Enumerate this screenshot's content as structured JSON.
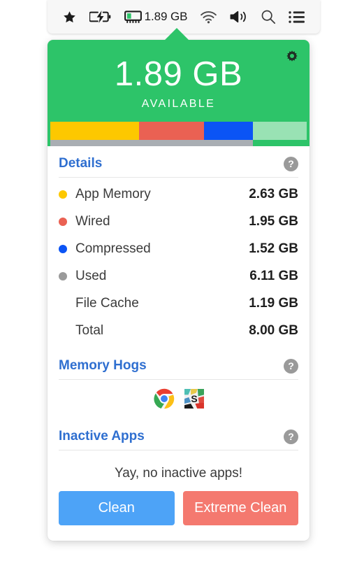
{
  "menubar": {
    "icons": [
      {
        "name": "star-icon",
        "label": "star"
      },
      {
        "name": "battery-charging-icon",
        "label": "battery charging"
      },
      {
        "name": "ram-chip-icon",
        "label": "memory chip"
      }
    ],
    "ram_text": "1.89 GB",
    "trailing_icons": [
      {
        "name": "wifi-icon",
        "label": "wifi"
      },
      {
        "name": "volume-icon",
        "label": "volume"
      },
      {
        "name": "search-icon",
        "label": "search"
      },
      {
        "name": "list-icon",
        "label": "notification center"
      }
    ]
  },
  "header": {
    "available_value": "1.89 GB",
    "available_label": "AVAILABLE",
    "gear_icon": "gear-icon",
    "background_color": "#2dc469"
  },
  "memory_bar": {
    "segments": [
      {
        "name": "app-memory",
        "color": "#fdc800",
        "percent": 34.5
      },
      {
        "name": "wired",
        "color": "#ea6153",
        "percent": 25.5
      },
      {
        "name": "compressed",
        "color": "#0b54f5",
        "percent": 19.0
      },
      {
        "name": "free",
        "color": "#99e2b4",
        "percent": 21.0
      }
    ],
    "underbar_color": "#a9aeb3",
    "underbar_percent": 79
  },
  "details": {
    "title": "Details",
    "help_label": "?",
    "rows": [
      {
        "dot": "#fdc800",
        "label": "App Memory",
        "value": "2.63 GB"
      },
      {
        "dot": "#ea6153",
        "label": "Wired",
        "value": "1.95 GB"
      },
      {
        "dot": "#0b54f5",
        "label": "Compressed",
        "value": "1.52 GB"
      },
      {
        "dot": "#9a9a9a",
        "label": "Used",
        "value": "6.11 GB"
      },
      {
        "dot": null,
        "label": "File Cache",
        "value": "1.19 GB"
      },
      {
        "dot": null,
        "label": "Total",
        "value": "8.00 GB"
      }
    ]
  },
  "memory_hogs": {
    "title": "Memory Hogs",
    "help_label": "?",
    "apps": [
      {
        "name": "chrome-app-icon",
        "label": "Google Chrome"
      },
      {
        "name": "slack-app-icon",
        "label": "Slack"
      }
    ]
  },
  "inactive_apps": {
    "title": "Inactive Apps",
    "help_label": "?",
    "message": "Yay, no inactive apps!",
    "clean_button": "Clean",
    "extreme_clean_button": "Extreme Clean",
    "clean_color": "#4da3f7",
    "extreme_color": "#f4796f"
  }
}
